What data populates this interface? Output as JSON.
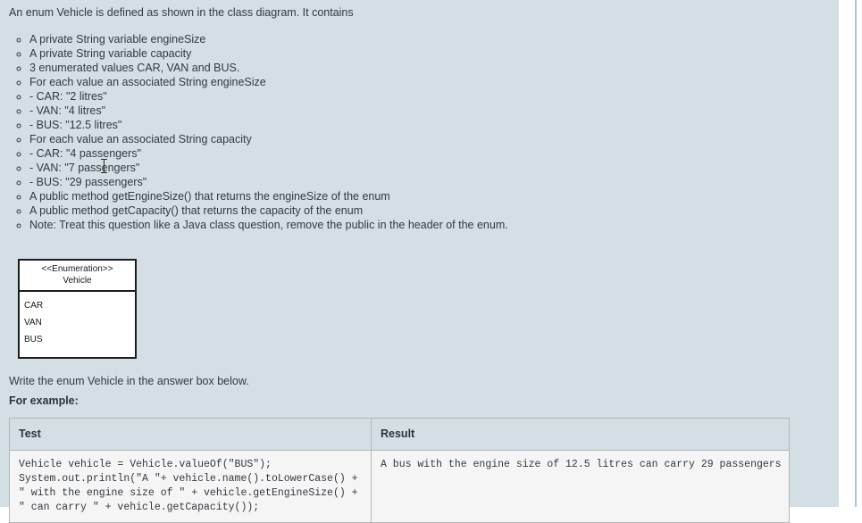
{
  "colors": {
    "page_background": "#d3dfe4",
    "text": "#2f3a42",
    "table_border": "#b6b6b6",
    "cell_background": "#f5f5f5",
    "diagram_border": "#1d1d1d",
    "right_rule": "#a8c4de"
  },
  "question": {
    "intro": "An enum Vehicle is defined as shown in the class diagram.  It contains",
    "requirements": [
      "A private String variable engineSize",
      "A private String variable capacity",
      "3 enumerated values CAR, VAN and BUS.",
      "For each value an associated String engineSize",
      "- CAR: \"2 litres\"",
      "- VAN: \"4 litres\"",
      "- BUS: \"12.5 litres\"",
      "For each value an associated String capacity",
      "- CAR: \"4 passengers\"",
      "- VAN: \"7 passengers\"",
      "- BUS: \"29 passengers\"",
      "A public method getEngineSize() that returns the engineSize of the enum",
      "A public method getCapacity() that returns the capacity of the enum",
      "Note:  Treat this question like a Java class question, remove the public in the header of the enum."
    ],
    "instruction": "Write the enum Vehicle in the answer box below.",
    "for_example_label": "For example:"
  },
  "class_diagram": {
    "stereotype": "<<Enumeration>>",
    "name": "Vehicle",
    "values": [
      "CAR",
      "VAN",
      "BUS"
    ]
  },
  "example_table": {
    "headers": {
      "test": "Test",
      "result": "Result"
    },
    "rows": [
      {
        "test": "Vehicle vehicle = Vehicle.valueOf(\"BUS\");\nSystem.out.println(\"A \"+ vehicle.name().toLowerCase() +\n\" with the engine size of \" + vehicle.getEngineSize() +\n\" can carry \" + vehicle.getCapacity());",
        "result": "A bus with the engine size of 12.5 litres can carry 29 passengers"
      }
    ]
  }
}
